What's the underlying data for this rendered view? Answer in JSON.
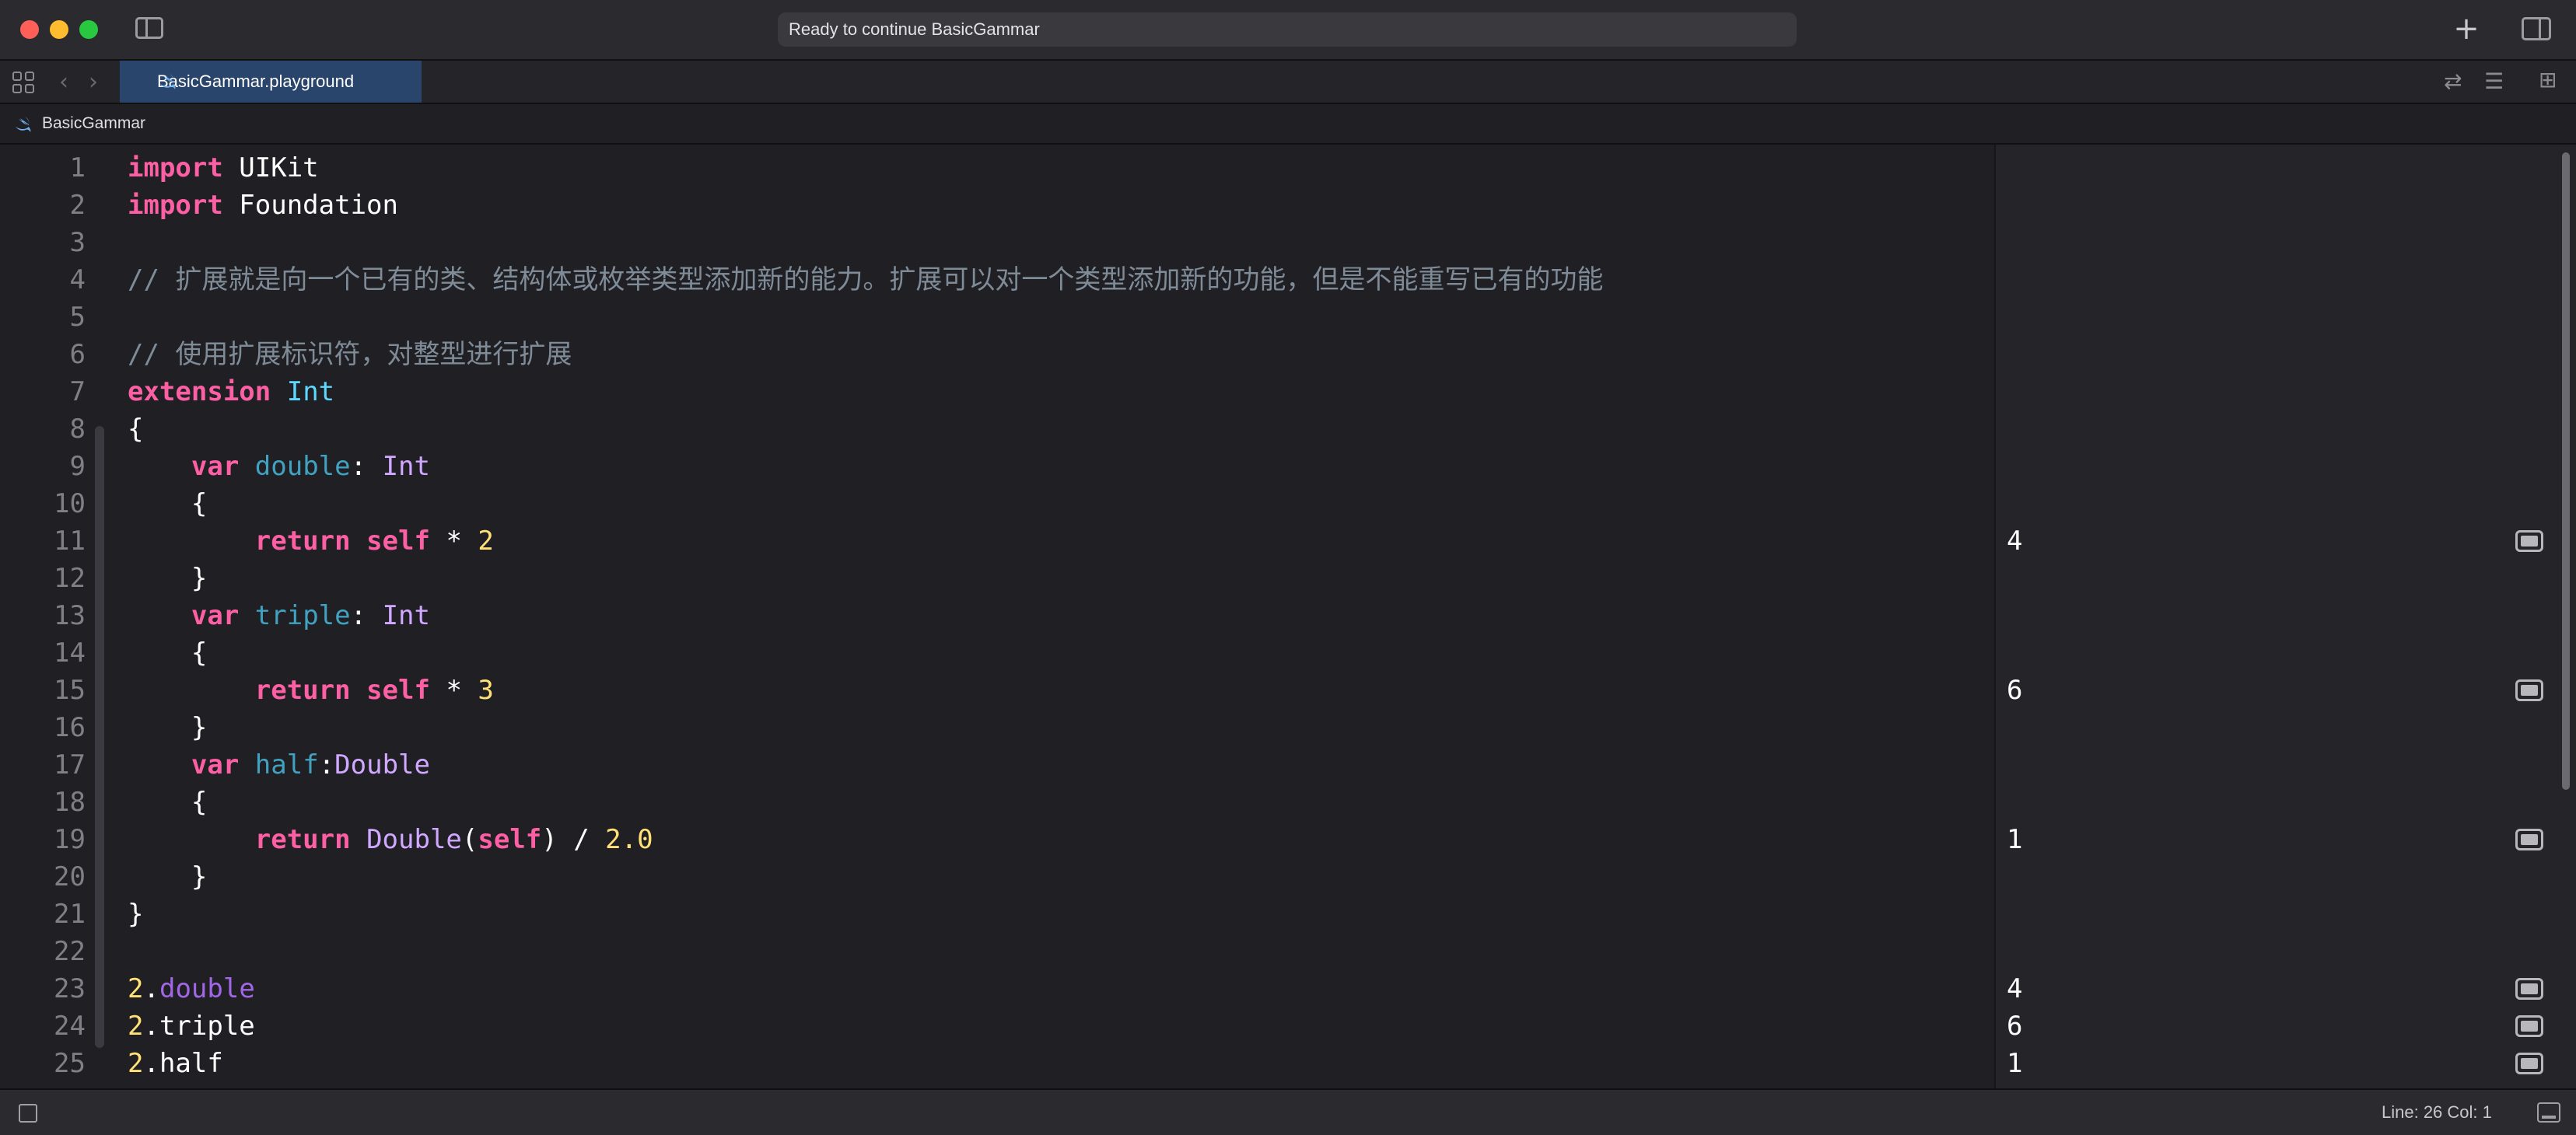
{
  "window": {
    "activity_status": "Ready to continue BasicGammar"
  },
  "tab": {
    "label": "BasicGammar.playground"
  },
  "breadcrumb": {
    "label": "BasicGammar"
  },
  "editor": {
    "line_numbers": [
      "1",
      "2",
      "3",
      "4",
      "5",
      "6",
      "7",
      "8",
      "9",
      "10",
      "11",
      "12",
      "13",
      "14",
      "15",
      "16",
      "17",
      "18",
      "19",
      "20",
      "21",
      "22",
      "23",
      "24",
      "25"
    ],
    "tokens": {
      "l1_kw": "import",
      "l1_rest": " UIKit",
      "l2_kw": "import",
      "l2_rest": " Foundation",
      "l4_comment": "// 扩展就是向一个已有的类、结构体或枚举类型添加新的能力。扩展可以对一个类型添加新的功能，但是不能重写已有的功能",
      "l6_comment": "// 使用扩展标识符，对整型进行扩展",
      "l7_kw": "extension",
      "l7_type": "Int",
      "l8": "{",
      "l9_kw": "var",
      "l9_name": "double",
      "l9_colon": ": ",
      "l9_type": "Int",
      "l10": "{",
      "l11_kw": "return",
      "l11_self": "self",
      "l11_op": " * ",
      "l11_num": "2",
      "l12": "}",
      "l13_kw": "var",
      "l13_name": "triple",
      "l13_colon": ": ",
      "l13_type": "Int",
      "l14": "{",
      "l15_kw": "return",
      "l15_self": "self",
      "l15_op": " * ",
      "l15_num": "3",
      "l16": "}",
      "l17_kw": "var",
      "l17_name": "half",
      "l17_colon": ":",
      "l17_type": "Double",
      "l18": "{",
      "l19_kw": "return",
      "l19_type": "Double",
      "l19_open": "(",
      "l19_self": "self",
      "l19_close": ") / ",
      "l19_num": "2.0",
      "l20": "}",
      "l21": "}",
      "l23_num": "2",
      "l23_dot": ".",
      "l23_member": "double",
      "l24_num": "2",
      "l24_rest": ".triple",
      "l25_num": "2",
      "l25_rest": ".half"
    }
  },
  "results": {
    "r11": "4",
    "r15": "6",
    "r19": "1",
    "r23": "4",
    "r24": "6",
    "r25": "1"
  },
  "statusbar": {
    "position": "Line: 26  Col: 1"
  },
  "colors": {
    "keyword": "#fc5fa3",
    "comment": "#7f8c98",
    "type": "#5dd8ff",
    "number": "#ffe176",
    "tab_active": "#29456b"
  },
  "icons": [
    "sidebar-toggle-icon",
    "plus-icon",
    "inspector-toggle-icon",
    "grid-icon",
    "back-arrow-icon",
    "forward-arrow-icon",
    "swift-icon",
    "related-items-icon",
    "editor-options-icon",
    "add-editor-icon",
    "quick-look-icon",
    "console-toggle-icon",
    "debug-area-icon"
  ]
}
